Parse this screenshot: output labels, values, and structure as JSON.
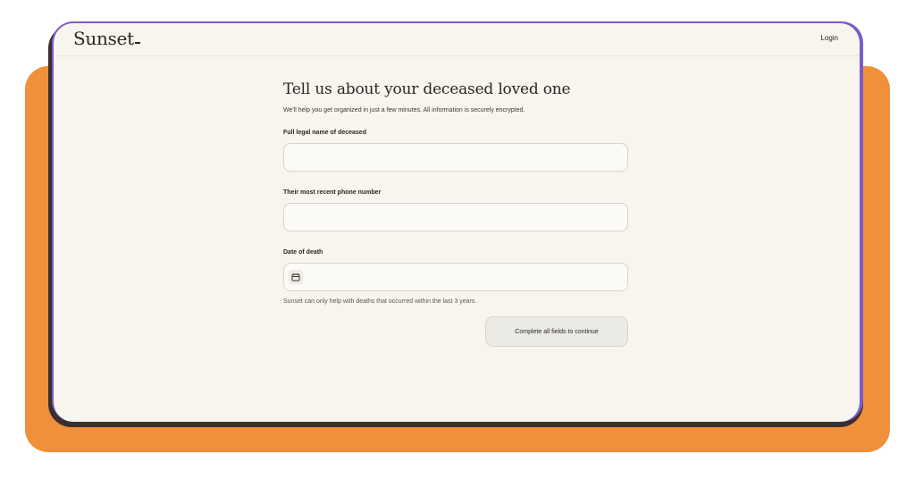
{
  "header": {
    "brand": "Sunset",
    "login_label": "Login"
  },
  "form": {
    "title": "Tell us about your deceased loved one",
    "subtitle": "We'll help you get organized in just a few minutes. All information is securely encrypted.",
    "fields": [
      {
        "label": "Full legal name of deceased",
        "value": "",
        "placeholder": ""
      },
      {
        "label": "Their most recent phone number",
        "value": "",
        "placeholder": ""
      },
      {
        "label": "Date of death",
        "value": "",
        "placeholder": "",
        "icon": "calendar-icon"
      }
    ],
    "date_hint": "Sunset can only help with deaths that occurred within the last 3 years.",
    "submit_label": "Complete all fields to continue",
    "submit_disabled": true
  },
  "colors": {
    "backdrop": "#F0903A",
    "page_background": "#F7F5EE",
    "text": "#2a2825",
    "input_border": "#D8D4CA",
    "button_background": "#ECEAE4"
  }
}
